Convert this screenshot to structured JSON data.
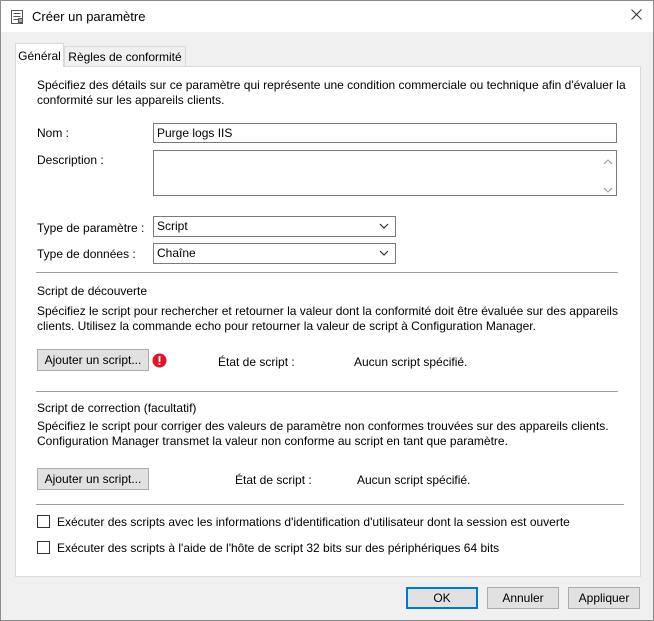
{
  "window": {
    "title": "Créer un paramètre",
    "icon": "document-settings-icon"
  },
  "tabs": [
    {
      "label": "Général",
      "active": true
    },
    {
      "label": "Règles de conformité",
      "active": false
    }
  ],
  "general": {
    "intro": "Spécifiez des détails sur ce paramètre qui représente une condition commerciale ou technique afin d'évaluer la conformité sur les appareils clients.",
    "name_label": "Nom :",
    "name_value": "Purge logs IIS",
    "description_label": "Description :",
    "description_value": "",
    "setting_type_label": "Type de paramètre :",
    "setting_type_value": "Script",
    "data_type_label": "Type de données :",
    "data_type_value": "Chaîne"
  },
  "discovery": {
    "heading": "Script de découverte",
    "text": "Spécifiez le script pour rechercher et retourner la valeur dont la conformité doit être évaluée sur des appareils clients. Utilisez la commande echo pour retourner la valeur de script à Configuration Manager.",
    "button": "Ajouter un script...",
    "status_label": "État de script :",
    "status_value": "Aucun script spécifié."
  },
  "remediation": {
    "heading": "Script de correction (facultatif)",
    "text": "Spécifiez le script pour corriger des valeurs de paramètre non conformes trouvées sur des appareils clients. Configuration Manager transmet la valeur non conforme au script en tant que paramètre.",
    "button": "Ajouter un script...",
    "status_label": "État de script :",
    "status_value": "Aucun script spécifié."
  },
  "options": {
    "run_as_user": "Exécuter des scripts avec les informations d'identification d'utilisateur dont la session est ouverte",
    "run_32bit": "Exécuter des scripts à l'aide de l'hôte de script 32 bits sur des périphériques 64 bits"
  },
  "footer": {
    "ok": "OK",
    "cancel": "Annuler",
    "apply": "Appliquer"
  },
  "colors": {
    "accent": "#0078d7",
    "warning": "#e81123"
  }
}
